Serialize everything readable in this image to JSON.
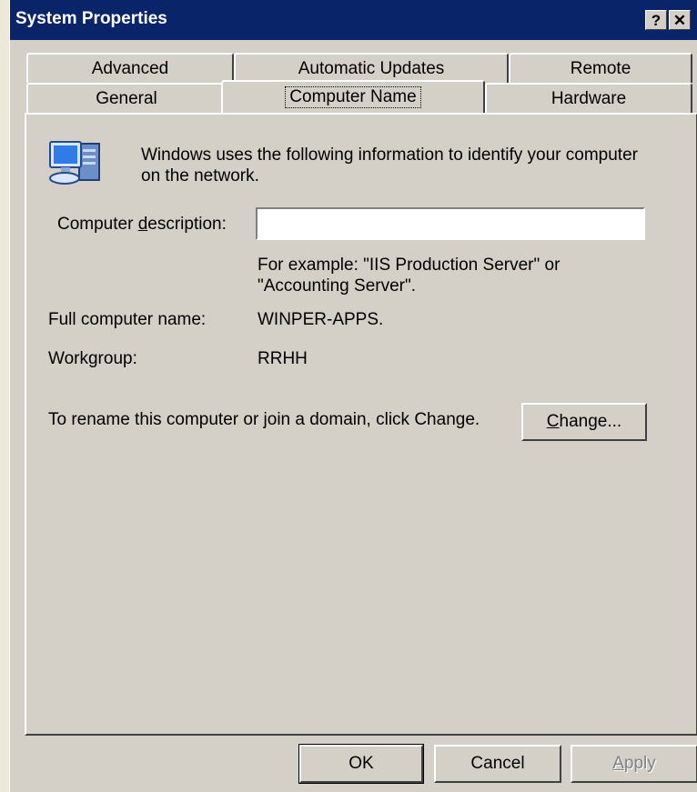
{
  "window": {
    "title": "System Properties",
    "help_button": "?",
    "close_button": "✕"
  },
  "tabs": {
    "row1": [
      {
        "label": "Advanced"
      },
      {
        "label": "Automatic Updates"
      },
      {
        "label": "Remote"
      }
    ],
    "row2": [
      {
        "label": "General"
      },
      {
        "label": "Computer Name",
        "active": true
      },
      {
        "label": "Hardware"
      }
    ]
  },
  "computer_name": {
    "intro_line1": "Windows uses the following information to identify your computer",
    "intro_line2": "on the network.",
    "description_label_pre": "Computer ",
    "description_label_accel": "d",
    "description_label_post": "escription:",
    "description_value": "",
    "example_line1": "For example: \"IIS Production Server\" or",
    "example_line2": "\"Accounting Server\".",
    "full_name_label": "Full computer name:",
    "full_name_value": "WINPER-APPS.",
    "workgroup_label": "Workgroup:",
    "workgroup_value": "RRHH",
    "rename_text": "To rename this computer or join a domain, click Change.",
    "change_accel": "C",
    "change_rest": "hange..."
  },
  "buttons": {
    "ok": "OK",
    "cancel": "Cancel",
    "apply_accel": "A",
    "apply_rest": "pply"
  },
  "icons": {
    "computer": "computer-network-icon"
  }
}
